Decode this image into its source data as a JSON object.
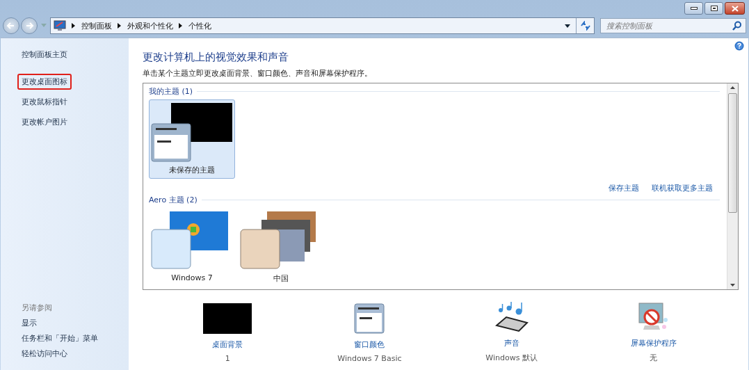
{
  "window": {
    "buttons": [
      {
        "kind": "minimize"
      },
      {
        "kind": "maximize"
      },
      {
        "kind": "close"
      }
    ]
  },
  "address_bar": {
    "breadcrumbs": [
      "控制面板",
      "外观和个性化",
      "个性化"
    ]
  },
  "search": {
    "placeholder": "搜索控制面板"
  },
  "sidebar": {
    "items": [
      {
        "label": "控制面板主页",
        "highlighted": false
      },
      {
        "label": "更改桌面图标",
        "highlighted": true
      },
      {
        "label": "更改鼠标指针",
        "highlighted": false
      },
      {
        "label": "更改帐户图片",
        "highlighted": false
      }
    ],
    "see_also_title": "另请参阅",
    "see_also": [
      "显示",
      "任务栏和「开始」菜单",
      "轻松访问中心"
    ]
  },
  "heading": "更改计算机上的视觉效果和声音",
  "description": "单击某个主题立即更改桌面背景、窗口颜色、声音和屏幕保护程序。",
  "theme_groups": [
    {
      "title": "我的主题 (1)",
      "themes": [
        {
          "kind": "unsaved",
          "label": "未保存的主题",
          "selected": true
        }
      ],
      "links": [
        "保存主题",
        "联机获取更多主题"
      ]
    },
    {
      "title": "Aero 主题 (2)",
      "themes": [
        {
          "kind": "windows7",
          "label": "Windows 7",
          "selected": false
        },
        {
          "kind": "china",
          "label": "中国",
          "selected": false
        }
      ]
    }
  ],
  "settings": [
    {
      "kind": "wallpaper",
      "label": "桌面背景",
      "value": "1"
    },
    {
      "kind": "window-color",
      "label": "窗口颜色",
      "value": "Windows 7 Basic"
    },
    {
      "kind": "sound",
      "label": "声音",
      "value": "Windows 默认"
    },
    {
      "kind": "screensaver",
      "label": "屏幕保护程序",
      "value": "无"
    }
  ]
}
